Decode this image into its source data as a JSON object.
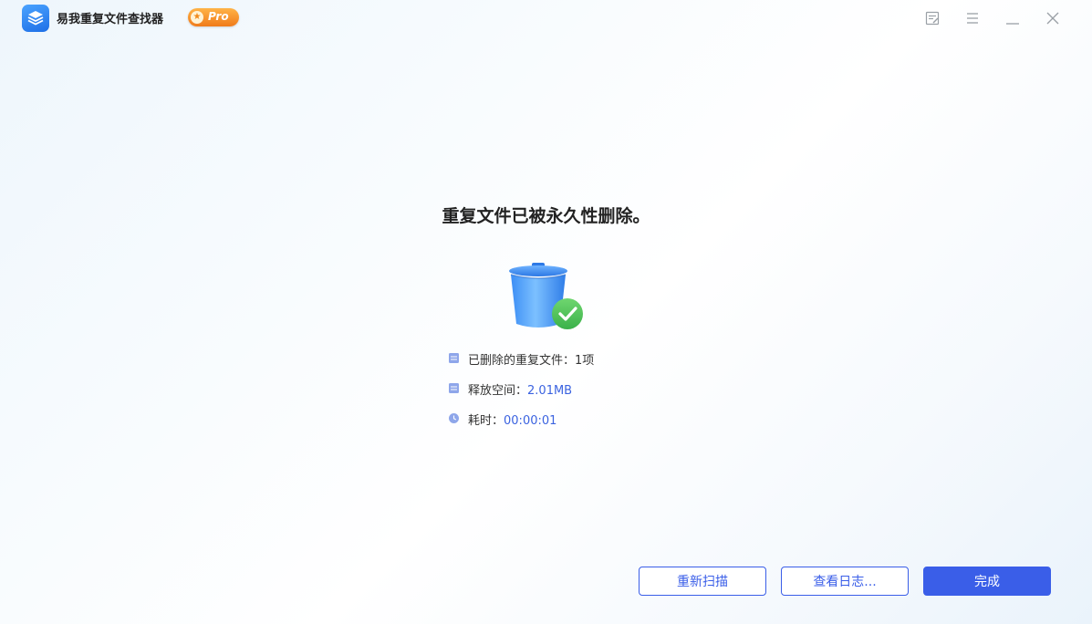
{
  "app": {
    "title": "易我重复文件查找器",
    "badge": "Pro"
  },
  "window_controls": {
    "feedback_icon": "feedback-icon",
    "menu_icon": "menu-icon",
    "minimize_icon": "minimize-icon",
    "close_icon": "close-icon"
  },
  "main": {
    "heading": "重复文件已被永久性删除。",
    "stats": [
      {
        "label": "已删除的重复文件：",
        "value": "1项"
      },
      {
        "label": "释放空间：",
        "value": "2.01MB"
      },
      {
        "label": "耗时：",
        "value": "00:00:01"
      }
    ]
  },
  "buttons": {
    "rescan": "重新扫描",
    "view_log": "查看日志...",
    "done": "完成"
  },
  "colors": {
    "accent": "#3a5ee8",
    "success": "#4cc45a",
    "value_text": "#3b63e0"
  }
}
